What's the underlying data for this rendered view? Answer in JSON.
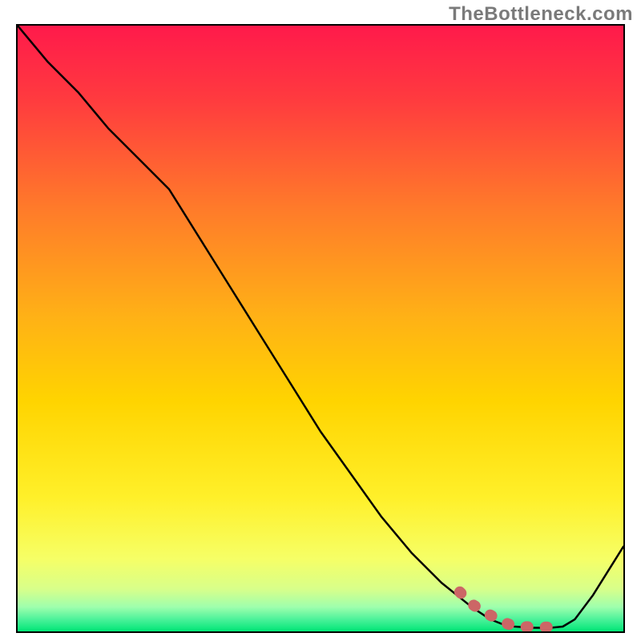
{
  "watermark": "TheBottleneck.com",
  "chart_data": {
    "type": "line",
    "title": "",
    "xlabel": "",
    "ylabel": "",
    "xlim": [
      0,
      100
    ],
    "ylim": [
      0,
      100
    ],
    "grid": false,
    "legend": false,
    "background": {
      "kind": "vertical-gradient",
      "top_color": "#ff1a4b",
      "mid_color": "#ffd400",
      "bottom_band_color": "#00e676"
    },
    "series": [
      {
        "name": "curve",
        "color": "#000000",
        "x": [
          0,
          5,
          10,
          15,
          20,
          25,
          30,
          35,
          40,
          45,
          50,
          55,
          60,
          65,
          70,
          75,
          78,
          80,
          82,
          85,
          88,
          90,
          92,
          95,
          100
        ],
        "y": [
          100,
          94,
          89,
          83,
          78,
          73,
          65,
          57,
          49,
          41,
          33,
          26,
          19,
          13,
          8,
          4,
          2,
          1.2,
          0.8,
          0.6,
          0.6,
          0.8,
          2,
          6,
          14
        ]
      }
    ],
    "highlights": [
      {
        "name": "dashed-segment",
        "color": "#cc6666",
        "style": "thick-dotted",
        "x": [
          73,
          75,
          77,
          79,
          80,
          81,
          82,
          83,
          85,
          86,
          88
        ],
        "y": [
          6.5,
          4.5,
          3.2,
          2.2,
          1.6,
          1.2,
          0.9,
          0.8,
          0.7,
          0.7,
          0.7
        ]
      }
    ]
  }
}
